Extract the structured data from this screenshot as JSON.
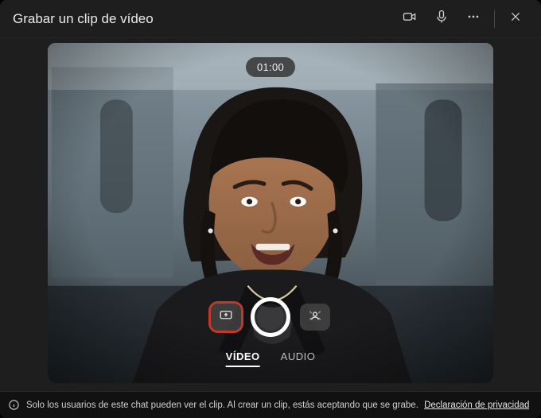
{
  "header": {
    "title": "Grabar un clip de vídeo"
  },
  "timer": "01:00",
  "tabs": {
    "video": "VÍDEO",
    "audio": "AUDIO",
    "active": "video"
  },
  "footer": {
    "message": "Solo los usuarios de este chat pueden ver el clip. Al crear un clip, estás aceptando que se grabe.",
    "privacy_link": "Declaración de privacidad"
  },
  "icons": {
    "camera": "camera-icon",
    "mic": "mic-icon",
    "more": "more-icon",
    "close": "close-icon",
    "screen_share": "screen-share-icon",
    "record": "record-icon",
    "effects": "background-effects-icon",
    "info": "info-icon"
  }
}
